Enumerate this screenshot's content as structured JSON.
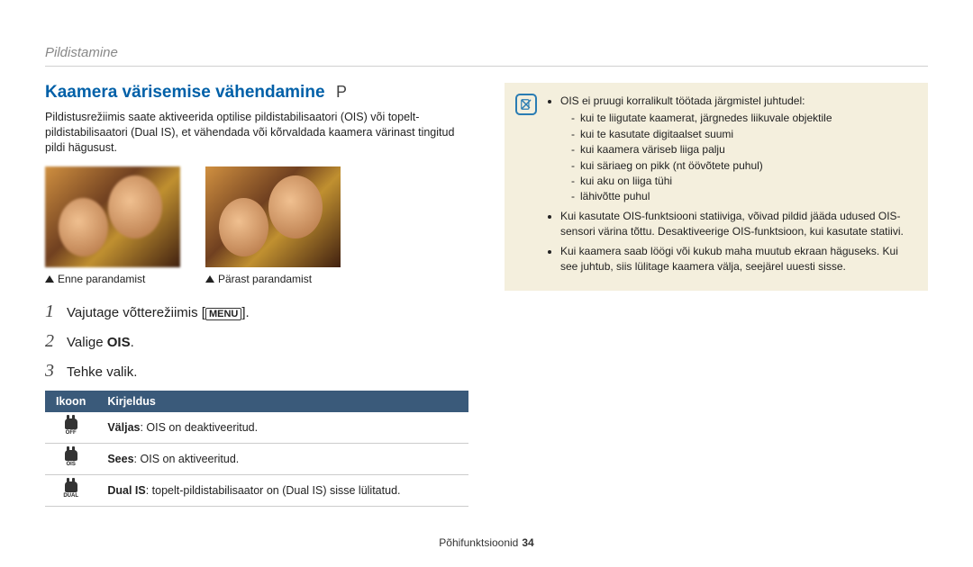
{
  "breadcrumb": "Pildistamine",
  "heading": "Kaamera värisemise vähendamine",
  "mode_letter": "P",
  "intro": "Pildistusrežiimis saate aktiveerida optilise pildistabilisaatori (OIS) või topelt-pildistabilisaatori (Dual IS), et vähendada või kõrvaldada kaamera värinast tingitud pildi hägusust.",
  "caption_before": "Enne parandamist",
  "caption_after": "Pärast parandamist",
  "steps": {
    "s1_pre": "Vajutage võtterežiimis [",
    "s1_menu": "MENU",
    "s1_post": "].",
    "s2_pre": "Valige ",
    "s2_bold": "OIS",
    "s2_post": ".",
    "s3": "Tehke valik."
  },
  "table": {
    "head_icon": "Ikoon",
    "head_desc": "Kirjeldus",
    "rows": [
      {
        "icon": "OFF",
        "bold": "Väljas",
        "rest": ": OIS on deaktiveeritud."
      },
      {
        "icon": "OIS",
        "bold": "Sees",
        "rest": ": OIS on aktiveeritud."
      },
      {
        "icon": "DUAL",
        "bold": "Dual IS",
        "rest": ": topelt-pildistabilisaator on (Dual IS) sisse lülitatud."
      }
    ]
  },
  "notes": {
    "b1_lead": "OIS ei pruugi korralikult töötada järgmistel juhtudel:",
    "b1_sub": [
      "kui te liigutate kaamerat, järgnedes liikuvale objektile",
      "kui te kasutate digitaalset suumi",
      "kui kaamera väriseb liiga palju",
      "kui säriaeg on pikk (nt öövõtete puhul)",
      "kui aku on liiga tühi",
      "lähivõtte puhul"
    ],
    "b2": "Kui kasutate OIS-funktsiooni statiiviga, võivad pildid jääda udused OIS-sensori värina tõttu. Desaktiveerige OIS-funktsioon, kui kasutate statiivi.",
    "b3": "Kui kaamera saab löögi või kukub maha muutub ekraan häguseks. Kui see juhtub, siis lülitage kaamera välja, seejärel uuesti sisse."
  },
  "footer_label": "Põhifunktsioonid",
  "footer_page": "34"
}
